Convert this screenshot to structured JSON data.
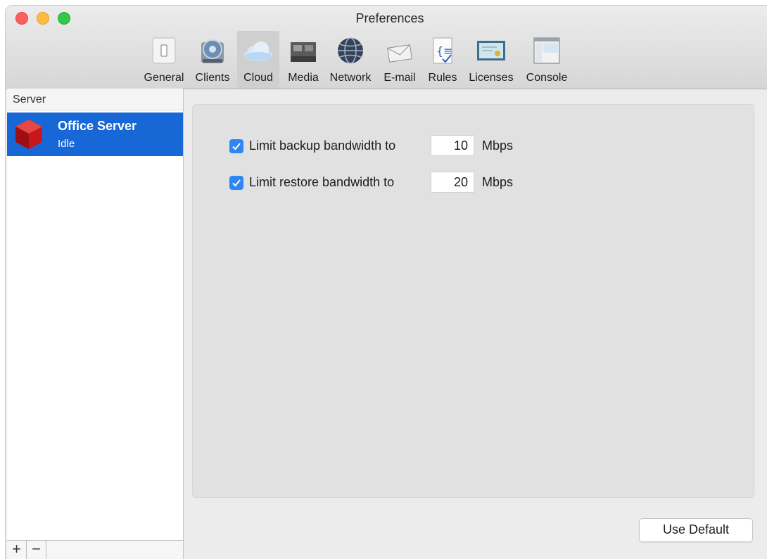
{
  "window": {
    "title": "Preferences"
  },
  "toolbar": {
    "items": [
      {
        "label": "General",
        "icon": "switch-icon"
      },
      {
        "label": "Clients",
        "icon": "client-drive-icon"
      },
      {
        "label": "Cloud",
        "icon": "cloud-icon",
        "active": true
      },
      {
        "label": "Media",
        "icon": "media-folder-icon"
      },
      {
        "label": "Network",
        "icon": "globe-icon"
      },
      {
        "label": "E-mail",
        "icon": "envelope-icon"
      },
      {
        "label": "Rules",
        "icon": "rules-document-icon"
      },
      {
        "label": "Licenses",
        "icon": "license-certificate-icon"
      },
      {
        "label": "Console",
        "icon": "console-window-icon"
      }
    ]
  },
  "sidebar": {
    "header": "Server",
    "servers": [
      {
        "name": "Office Server",
        "status": "Idle",
        "selected": true
      }
    ],
    "add_label": "+",
    "remove_label": "−"
  },
  "cloud": {
    "backup": {
      "label": "Limit backup bandwidth to",
      "checked": true,
      "value": "10",
      "unit": "Mbps"
    },
    "restore": {
      "label": "Limit restore bandwidth to",
      "checked": true,
      "value": "20",
      "unit": "Mbps"
    }
  },
  "footer": {
    "use_default_label": "Use Default"
  },
  "colors": {
    "accent": "#1867d6",
    "checkbox": "#2f86f2"
  }
}
